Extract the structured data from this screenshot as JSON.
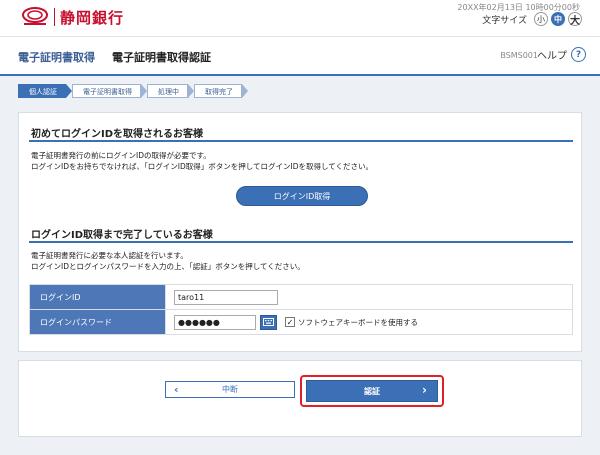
{
  "header": {
    "bank_name": "静岡銀行",
    "datetime": "20XX年02月13日 10時00分00秒",
    "font_size_label": "文字サイズ",
    "font_sizes": [
      "小",
      "中",
      "大"
    ],
    "font_size_selected": "中"
  },
  "titlebar": {
    "section": "電子証明書取得",
    "page": "電子証明書取得認証",
    "code": "BSMS001",
    "help": "ヘルプ",
    "help_icon": "?"
  },
  "steps": [
    "個人認証",
    "電子証明書取得",
    "処理中",
    "取得完了"
  ],
  "section1": {
    "title": "初めてログインIDを取得されるお客様",
    "text1": "電子証明書発行の前にログインIDの取得が必要です。",
    "text2": "ログインIDをお持ちでなければ、「ログインID取得」ボタンを押してログインIDを取得してください。",
    "button": "ログインID取得"
  },
  "section2": {
    "title": "ログインID取得まで完了しているお客様",
    "text1": "電子証明書発行に必要な本人認証を行います。",
    "text2": "ログインIDとログインパスワードを入力の上、「認証」ボタンを押してください。",
    "login_id_label": "ログインID",
    "login_id_value": "taro11",
    "password_label": "ログインパスワード",
    "password_value": "●●●●●●",
    "software_keyboard_label": "ソフトウェアキーボードを使用する",
    "software_keyboard_checked": "✓"
  },
  "actions": {
    "cancel": "中断",
    "authenticate": "認証",
    "back_chevron": "‹",
    "next_chevron": "›"
  },
  "colors": {
    "brand_red": "#c8102e",
    "primary_blue": "#3b6fb6",
    "highlight_red": "#e0202a"
  }
}
